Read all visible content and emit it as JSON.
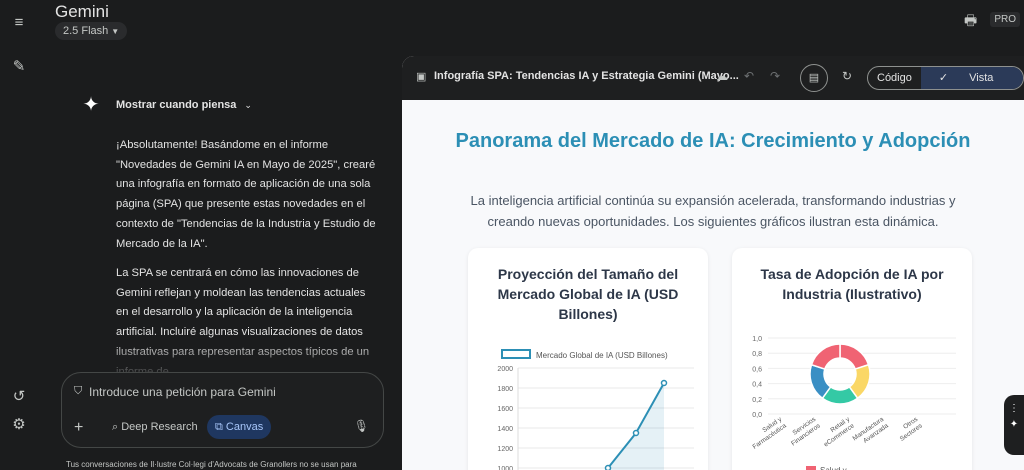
{
  "app": {
    "name": "Gemini",
    "model": "2.5 Flash",
    "badge": "PRO"
  },
  "chat": {
    "thinking_label": "Mostrar cuando piensa",
    "paragraph1": "¡Absolutamente! Basándome en el informe \"Novedades de Gemini IA en Mayo de 2025\", crearé una infografía en formato de aplicación de una sola página (SPA) que presente estas novedades en el contexto de \"Tendencias de la Industria y Estudio de Mercado de la IA\".",
    "paragraph2": "La SPA se centrará en cómo las innovaciones de Gemini reflejan y moldean las tendencias actuales en el desarrollo y la aplicación de la inteligencia artificial. Incluiré algunas visualizaciones de datos ilustrativas para representar aspectos típicos de un informe de"
  },
  "composer": {
    "placeholder": "Introduce una petición para Gemini",
    "deep_research": "Deep Research",
    "canvas": "Canvas"
  },
  "disclaimer": "Tus conversaciones de Il·lustre Col·legi d'Advocats de Granollers no se usan para",
  "canvas": {
    "doc_title": "Infografía SPA: Tendencias IA y Estrategia Gemini (Mayo...",
    "code_label": "Código",
    "preview_label": "Vista previa"
  },
  "preview": {
    "title": "Panorama del Mercado de IA: Crecimiento y Adopción",
    "subtitle": "La inteligencia artificial continúa su expansión acelerada, transformando industrias y creando nuevas oportunidades. Los siguientes gráficos ilustran esta dinámica.",
    "card1_title": "Proyección del Tamaño del Mercado Global de IA (USD Billones)",
    "card2_title": "Tasa de Adopción de IA por Industria (Ilustrativo)"
  },
  "chart_data": [
    {
      "type": "line",
      "title": "Proyección del Tamaño del Mercado Global de IA (USD Billones)",
      "series": [
        {
          "name": "Mercado Global de IA (USD Billones)",
          "values": [
            1000,
            1350,
            1850
          ]
        }
      ],
      "yticks": [
        2000,
        1800,
        1600,
        1400,
        1200,
        1000
      ],
      "ylim": [
        1000,
        2000
      ],
      "color": "#2c8fb5"
    },
    {
      "type": "pie",
      "title": "Tasa de Adopción de IA por Industria (Ilustrativo)",
      "categories": [
        "Salud y Farmacéutica",
        "Servicios Financieros",
        "Retail y eCommerce",
        "Manufactura Avanzada",
        "Otros Sectores"
      ],
      "yticks": [
        "1,0",
        "0,8",
        "0,6",
        "0,4",
        "0,2",
        "0,0"
      ],
      "legend_first": "Salud y",
      "colors": [
        "#f06373",
        "#fad766",
        "#34c9a5",
        "#3a8fc4",
        "#f06373"
      ]
    }
  ]
}
